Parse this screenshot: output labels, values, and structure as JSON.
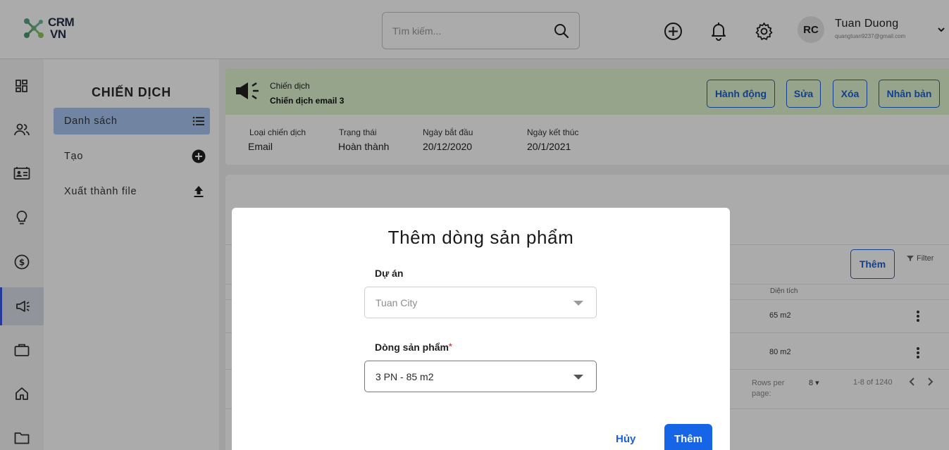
{
  "app": {
    "logo_line1": "CRM",
    "logo_line2": "VN"
  },
  "header": {
    "search_placeholder": "Tìm kiếm...",
    "user": {
      "initials": "RC",
      "name": "Tuan Duong",
      "email": "quangtuan9237@gmail.com"
    }
  },
  "rail": {
    "items": [
      "dashboard-icon",
      "contacts-icon",
      "contact-card-icon",
      "lightbulb-icon",
      "dollar-icon",
      "megaphone-icon",
      "briefcase-icon",
      "home-icon",
      "folder-icon"
    ],
    "active_index": 5
  },
  "subnav": {
    "title": "CHIẾN DỊCH",
    "items": [
      {
        "label": "Danh sách",
        "icon": "list-icon"
      },
      {
        "label": "Tạo",
        "icon": "add-circle-icon"
      },
      {
        "label": "Xuất thành file",
        "icon": "upload-icon"
      }
    ]
  },
  "campaign": {
    "kicker": "Chiến dịch",
    "name": "Chiến dịch email 3",
    "actions": [
      "Hành động",
      "Sửa",
      "Xóa",
      "Nhân bản"
    ],
    "fields": [
      {
        "label": "Loại chiến dịch",
        "value": "Email"
      },
      {
        "label": "Trạng thái",
        "value": "Hoàn thành"
      },
      {
        "label": "Ngày bắt đầu",
        "value": "20/12/2020"
      },
      {
        "label": "Ngày kết thúc",
        "value": "20/1/2021"
      }
    ]
  },
  "table": {
    "add_label": "Thêm",
    "filter_label": "Filter",
    "column": "Diện tích",
    "rows": [
      "65 m2",
      "80 m2"
    ],
    "rows_per_page_label": "Rows per page:",
    "rows_per_page": "8",
    "range": "1-8 of 1240"
  },
  "modal": {
    "title": "Thêm dòng sản phẩm",
    "project_label": "Dự án",
    "project_value": "Tuan City",
    "line_label": "Dòng sản phẩm",
    "required_mark": "*",
    "line_value": "3 PN - 85 m2",
    "cancel_label": "Hủy",
    "ok_label": "Thêm"
  },
  "colors": {
    "accent": "#1565e6",
    "banner": "#dff5cf",
    "active_nav": "#a9c6f2"
  }
}
